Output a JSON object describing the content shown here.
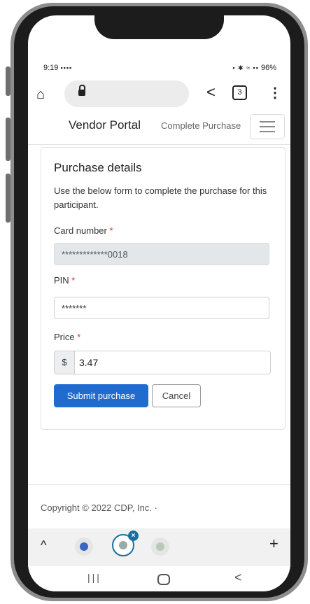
{
  "status_bar": {
    "time": "9:19",
    "left_icons": "▪▪▪▪",
    "right_icons": "▪ ✱ ≈ ▪▪",
    "battery": "96%"
  },
  "browser": {
    "tab_count": "3"
  },
  "nav": {
    "brand": "Vendor Portal",
    "breadcrumb": "Complete Purchase"
  },
  "card": {
    "title": "Purchase details",
    "description": "Use the below form to complete the purchase for this participant.",
    "card_number": {
      "label": "Card number",
      "required_mark": "*",
      "value": "*************0018"
    },
    "pin": {
      "label": "PIN",
      "required_mark": "*",
      "value": "*******"
    },
    "price": {
      "label": "Price",
      "required_mark": "*",
      "currency": "$",
      "value": "3.47"
    },
    "submit_label": "Submit purchase",
    "cancel_label": "Cancel"
  },
  "footer": {
    "copyright": "Copyright © 2022 CDP, Inc. ·"
  },
  "bottom_bar": {
    "close_badge": "×",
    "plus": "+"
  },
  "colors": {
    "primary": "#1f6bd0",
    "required": "#d9372b",
    "disabled_bg": "#e4e7ea"
  }
}
